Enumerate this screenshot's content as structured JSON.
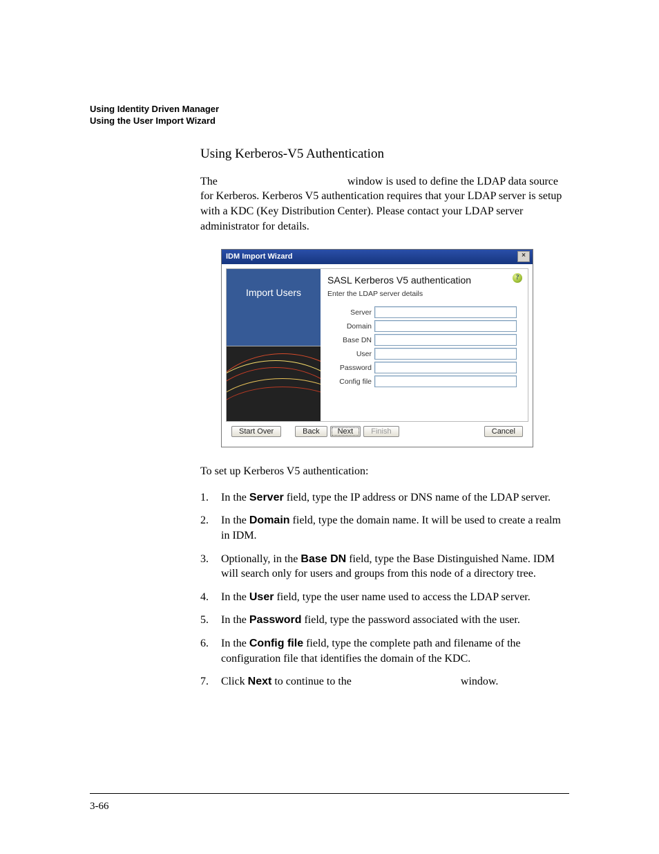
{
  "header": {
    "line1": "Using Identity Driven Manager",
    "line2": "Using the User Import Wizard"
  },
  "section_title": "Using Kerberos-V5 Authentication",
  "intro": {
    "prefix": "The ",
    "suffix": " window is used to define the LDAP data source for Kerberos. Kerberos V5 authentication requires that your LDAP server is setup with a KDC (Key Distribution Center). Please contact your LDAP server administrator for details."
  },
  "wizard": {
    "title": "IDM Import Wizard",
    "left_title": "Import Users",
    "right_title": "SASL Kerberos V5 authentication",
    "right_sub": "Enter the LDAP server details",
    "help": "?",
    "close": "×",
    "fields": {
      "server": "Server",
      "domain": "Domain",
      "basedn": "Base DN",
      "user": "User",
      "password": "Password",
      "config": "Config file"
    },
    "buttons": {
      "start_over": "Start Over",
      "back": "Back",
      "next": "Next",
      "finish": "Finish",
      "cancel": "Cancel"
    }
  },
  "para_setup": "To set up Kerberos V5 authentication:",
  "steps": {
    "s1a": "In the ",
    "s1b": "Server",
    "s1c": " field, type the IP address or DNS name of the LDAP server.",
    "s2a": "In the ",
    "s2b": "Domain",
    "s2c": " field, type the domain name. It will be used to create a realm in IDM.",
    "s3a": "Optionally, in the ",
    "s3b": "Base DN",
    "s3c": " field, type the Base Distinguished Name. IDM will search only for users and groups from this node of a directory tree.",
    "s4a": "In the ",
    "s4b": "User",
    "s4c": " field, type the user name used to access the LDAP server.",
    "s5a": "In the ",
    "s5b": "Password",
    "s5c": " field, type the password associated with the user.",
    "s6a": "In the ",
    "s6b": "Config file",
    "s6c": " field, type the complete path and filename of the configuration file that identifies the domain of the KDC.",
    "s7a": "Click ",
    "s7b": "Next",
    "s7c": " to continue to the ",
    "s7d": " window."
  },
  "footer": "3-66"
}
